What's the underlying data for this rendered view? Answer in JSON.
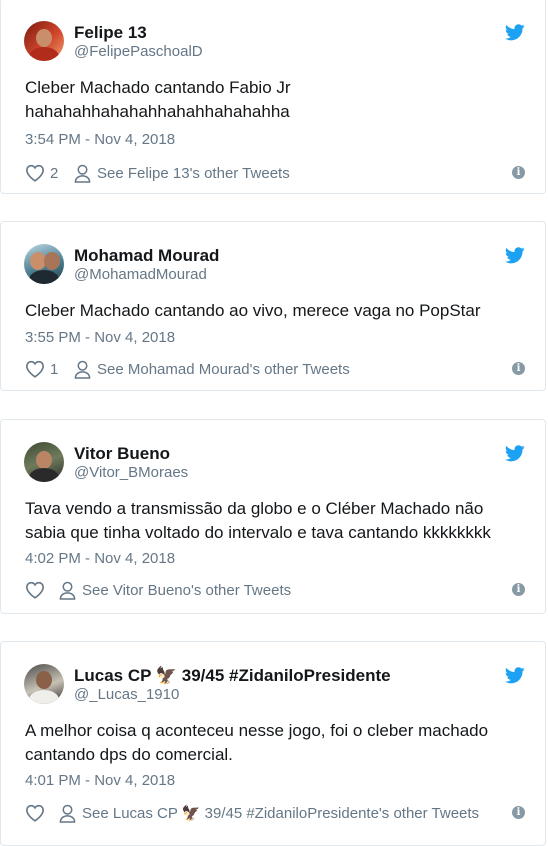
{
  "tweets": [
    {
      "name": "Felipe 13",
      "handle": "@FelipePaschoalD",
      "text": "Cleber Machado cantando Fabio Jr hahahahhahahahhahahhahahahha",
      "time": "3:54 PM - Nov 4, 2018",
      "likes": "2",
      "other_link": "See Felipe 13's other Tweets"
    },
    {
      "name": "Mohamad Mourad",
      "handle": "@MohamadMourad",
      "text": "Cleber Machado cantando ao vivo, merece vaga no PopStar",
      "time": "3:55 PM - Nov 4, 2018",
      "likes": "1",
      "other_link": "See Mohamad Mourad's other Tweets"
    },
    {
      "name": "Vitor Bueno",
      "handle": "@Vitor_BMoraes",
      "text": "Tava vendo a transmissão da globo e o Cléber Machado não sabia que tinha voltado do intervalo e tava cantando kkkkkkkk",
      "time": "4:02 PM - Nov 4, 2018",
      "likes": "",
      "other_link": "See Vitor Bueno's other Tweets"
    },
    {
      "name": "Lucas CP 🦅 39/45 #ZidaniloPresidente",
      "handle": "@_Lucas_1910",
      "text": "A melhor coisa q aconteceu nesse jogo, foi o cleber machado cantando dps do comercial.",
      "time": "4:01 PM - Nov 4, 2018",
      "likes": "",
      "other_link": "See Lucas CP 🦅 39/45 #ZidaniloPresidente's other Tweets"
    }
  ],
  "icons": {
    "brand": "twitter-bird-icon",
    "like": "heart-icon",
    "profile": "person-icon",
    "info": "info-icon"
  },
  "colors": {
    "twitter_blue": "#1da1f2",
    "secondary_text": "#657786",
    "border": "#e1e8ed"
  }
}
